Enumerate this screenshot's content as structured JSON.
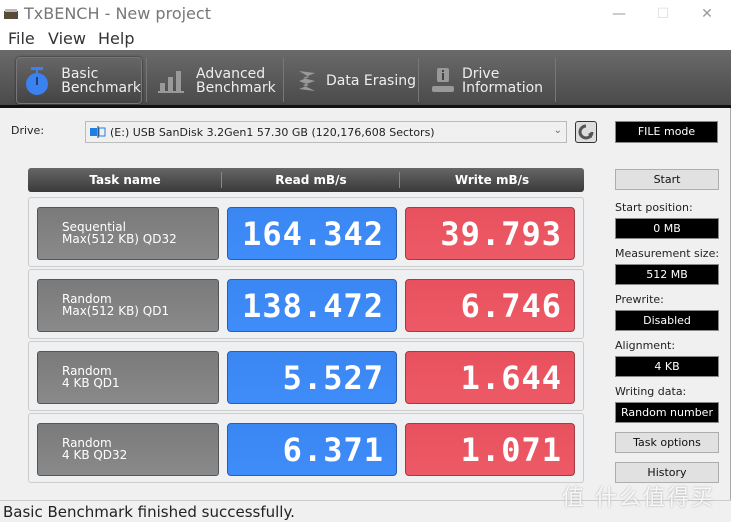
{
  "window": {
    "title": "TxBENCH - New project",
    "controls": {
      "minimize": "—",
      "maximize": "☐",
      "close": "✕"
    }
  },
  "menu": [
    "File",
    "View",
    "Help"
  ],
  "toolbar": {
    "tabs": [
      {
        "line1": "Basic",
        "line2": "Benchmark",
        "icon": "stopwatch-icon",
        "active": true
      },
      {
        "line1": "Advanced",
        "line2": "Benchmark",
        "icon": "bar-chart-icon",
        "active": false
      },
      {
        "line1": "Data Erasing",
        "line2": "",
        "icon": "eraser-icon",
        "active": false
      },
      {
        "line1": "Drive",
        "line2": "Information",
        "icon": "drive-info-icon",
        "active": false
      }
    ]
  },
  "drive": {
    "label": "Drive:",
    "selected": "(E:) USB SanDisk 3.2Gen1  57.30 GB (120,176,608 Sectors)",
    "mode": "FILE mode"
  },
  "table": {
    "headers": [
      "Task name",
      "Read mB/s",
      "Write mB/s"
    ],
    "rows": [
      {
        "task_line1": "Sequential",
        "task_line2": "Max(512 KB) QD32",
        "read": "164.342",
        "write": "39.793"
      },
      {
        "task_line1": "Random",
        "task_line2": "Max(512 KB) QD1",
        "read": "138.472",
        "write": "6.746"
      },
      {
        "task_line1": "Random",
        "task_line2": "4 KB QD1",
        "read": "5.527",
        "write": "1.644"
      },
      {
        "task_line1": "Random",
        "task_line2": "4 KB QD32",
        "read": "6.371",
        "write": "1.071"
      }
    ]
  },
  "side": {
    "start_button": "Start",
    "start_position_label": "Start position:",
    "start_position": "0 MB",
    "measurement_size_label": "Measurement size:",
    "measurement_size": "512 MB",
    "prewrite_label": "Prewrite:",
    "prewrite": "Disabled",
    "alignment_label": "Alignment:",
    "alignment": "4 KB",
    "writing_data_label": "Writing data:",
    "writing_data": "Random number",
    "task_options_button": "Task options",
    "history_button": "History"
  },
  "status": "Basic Benchmark finished successfully.",
  "watermark": "值 什么值得买",
  "colors": {
    "read": "#3f8dfa",
    "write": "#ed5a66",
    "task": "#808080",
    "active_icon": "#3b82f0"
  }
}
